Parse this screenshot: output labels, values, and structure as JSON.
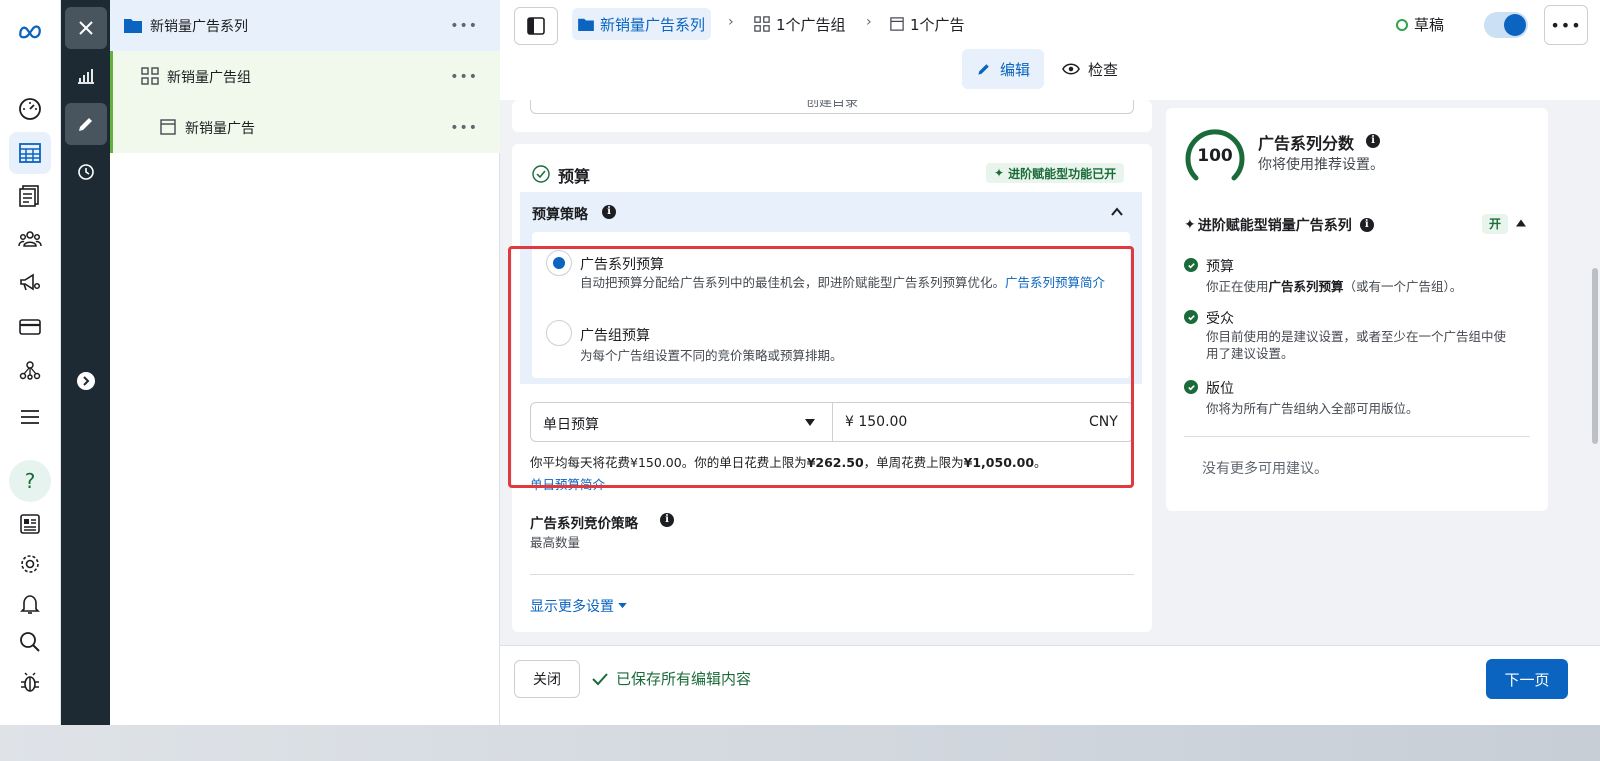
{
  "tree": {
    "campaign": "新销量广告系列",
    "adset": "新销量广告组",
    "ad": "新销量广告",
    "more": "•••"
  },
  "topbar": {
    "crumb_campaign": "新销量广告系列",
    "crumb_adsets": "1个广告组",
    "crumb_ads": "1个广告",
    "status": "草稿",
    "more": "•••",
    "tab_edit": "编辑",
    "tab_review": "检查"
  },
  "content": {
    "create_label": "创建目录"
  },
  "budget": {
    "title": "预算",
    "advantage_badge": "进阶赋能型功能已开",
    "strategy_title": "预算策略",
    "option1_title": "广告系列预算",
    "option1_desc": "自动把预算分配给广告系列中的最佳机会，即进阶赋能型广告系列预算优化。",
    "option1_link": "广告系列预算简介",
    "option2_title": "广告组预算",
    "option2_desc": "为每个广告组设置不同的竞价策略或预算排期。",
    "budget_type": "单日预算",
    "amount": "¥ 150.00",
    "currency": "CNY",
    "spend_note_1": "你平均每天将花费¥150.00。你的单日花费上限为",
    "spend_daily_max": "¥262.50",
    "spend_note_2": "，单周花费上限为",
    "spend_weekly_max": "¥1,050.00",
    "spend_note_3": "。",
    "daily_link": "单日预算简介",
    "bid_title": "广告系列竞价策略",
    "bid_value": "最高数量",
    "show_more": "显示更多设置"
  },
  "score": {
    "value": "100",
    "title": "广告系列分数",
    "subtitle": "你将使用推荐设置。",
    "advantage_title": "进阶赋能型销量广告系列",
    "advantage_state": "开",
    "items": [
      {
        "title": "预算",
        "desc_1": "你正在使用",
        "desc_bold": "广告系列预算",
        "desc_2": "（或有一个广告组）。"
      },
      {
        "title": "受众",
        "desc_1": "你目前使用的是建议设置，或者至少在一个广告组中使",
        "desc_bold": "",
        "desc_2": "用了建议设置。"
      },
      {
        "title": "版位",
        "desc_1": "你将为所有广告组纳入全部可用版位。",
        "desc_bold": "",
        "desc_2": ""
      }
    ],
    "no_more": "没有更多可用建议。"
  },
  "footer": {
    "close": "关闭",
    "saved": "已保存所有编辑内容",
    "next": "下一页"
  },
  "colors": {
    "primary": "#0b64c0",
    "success": "#1b6b3a",
    "highlight": "#e0393e",
    "dark_rail": "#1e2a33"
  }
}
